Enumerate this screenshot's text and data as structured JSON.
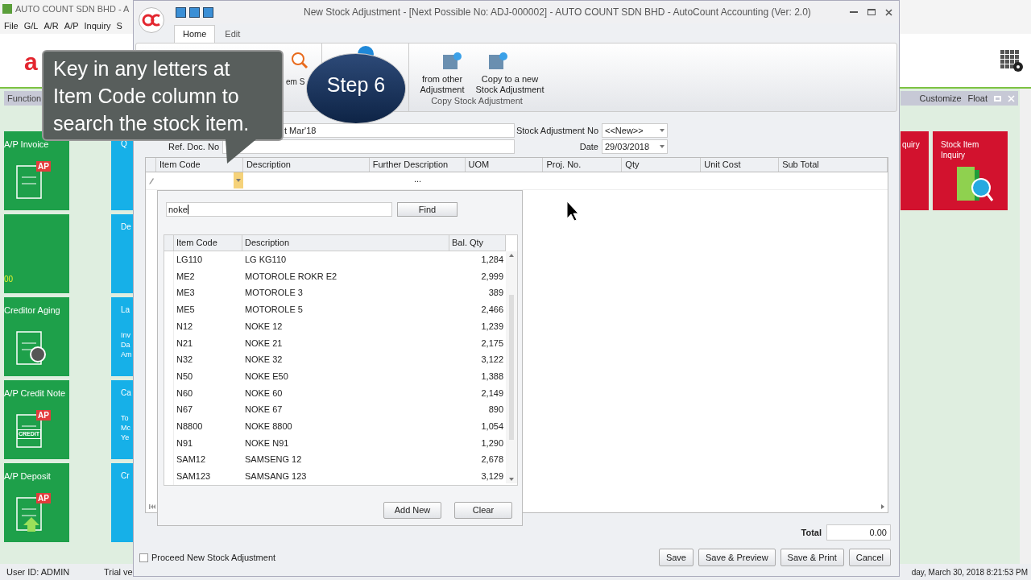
{
  "app": {
    "title": "AUTO COUNT SDN BHD - A",
    "menu": [
      "File",
      "G/L",
      "A/R",
      "A/P",
      "Inquiry",
      "S"
    ],
    "logo": "a"
  },
  "function_panel": {
    "tab": "Function",
    "green_tiles": [
      {
        "label": "A/P Invoice",
        "badge": "AP",
        "kind": "invoice"
      },
      {
        "label": "00",
        "kind": "amount"
      },
      {
        "label": "Creditor Aging",
        "kind": "aging"
      },
      {
        "label": "A/P Credit Note",
        "badge": "AP",
        "stamp": "CREDIT",
        "kind": "credit"
      },
      {
        "label": "A/P Deposit",
        "badge": "AP",
        "kind": "deposit"
      }
    ],
    "blue_tiles": [
      {
        "title": "Q"
      },
      {
        "title": "De"
      },
      {
        "title": "La",
        "lines": [
          "Inv",
          "Da",
          "Am"
        ]
      },
      {
        "title": "Ca",
        "lines": [
          "To",
          "Mc",
          "Ye"
        ]
      },
      {
        "title": "Cr"
      }
    ]
  },
  "right_panel": {
    "actions": [
      "Customize",
      "Float"
    ],
    "tiles": [
      "quiry",
      "Stock Item Inquiry"
    ]
  },
  "status_bar": {
    "user": "User ID: ADMIN",
    "license": "Trial ve",
    "datetime": "day, March 30, 2018  8:21:53 PM"
  },
  "dialog": {
    "title": "New Stock Adjustment - [Next Possible No: ADJ-000002] - AUTO COUNT SDN BHD - AutoCount Accounting (Ver: 2.0)",
    "tabs": [
      {
        "label": "Home",
        "selected": true
      },
      {
        "label": "Edit",
        "selected": false
      }
    ],
    "ribbon": {
      "partial_button": "em S",
      "buttons": [
        "from other Adjustment",
        "Copy to a new Stock Adjustment"
      ],
      "group": "Copy Stock Adjustment"
    },
    "form": {
      "description": "t Mar'18",
      "ref_label": "Ref. Doc. No",
      "no_label": "Stock Adjustment No",
      "no_value": "<<New>>",
      "date_label": "Date",
      "date_value": "29/03/2018"
    },
    "grid": {
      "columns": [
        "Item Code",
        "Description",
        "Further Description",
        "UOM",
        "Proj. No.",
        "Qty",
        "Unit Cost",
        "Sub Total"
      ],
      "row_ellipsis": "..."
    },
    "lookup": {
      "search": "noke",
      "find": "Find",
      "columns": [
        "Item Code",
        "Description",
        "Bal. Qty"
      ],
      "rows": [
        [
          "LG110",
          "LG KG110",
          "1,284"
        ],
        [
          "ME2",
          "MOTOROLE ROKR E2",
          "2,999"
        ],
        [
          "ME3",
          "MOTOROLE 3",
          "389"
        ],
        [
          "ME5",
          "MOTOROLE 5",
          "2,466"
        ],
        [
          "N12",
          "NOKE 12",
          "1,239"
        ],
        [
          "N21",
          "NOKE 21",
          "2,175"
        ],
        [
          "N32",
          "NOKE 32",
          "3,122"
        ],
        [
          "N50",
          "NOKE E50",
          "1,388"
        ],
        [
          "N60",
          "NOKE 60",
          "2,149"
        ],
        [
          "N67",
          "NOKE 67",
          "890"
        ],
        [
          "N8800",
          "NOKE 8800",
          "1,054"
        ],
        [
          "N91",
          "NOKE N91",
          "1,290"
        ],
        [
          "SAM12",
          "SAMSENG 12",
          "2,678"
        ],
        [
          "SAM123",
          "SAMSANG 123",
          "3,129"
        ]
      ],
      "buttons": [
        "Add New",
        "Clear"
      ]
    },
    "total": {
      "label": "Total",
      "value": "0.00"
    },
    "proceed": {
      "label": "Proceed New Stock Adjustment",
      "checked": false
    },
    "buttons": [
      "Save",
      "Save & Preview",
      "Save & Print",
      "Cancel"
    ]
  },
  "tutorial": {
    "callout": "Key in any letters at Item Code column to search the stock item.",
    "step": "Step 6"
  }
}
